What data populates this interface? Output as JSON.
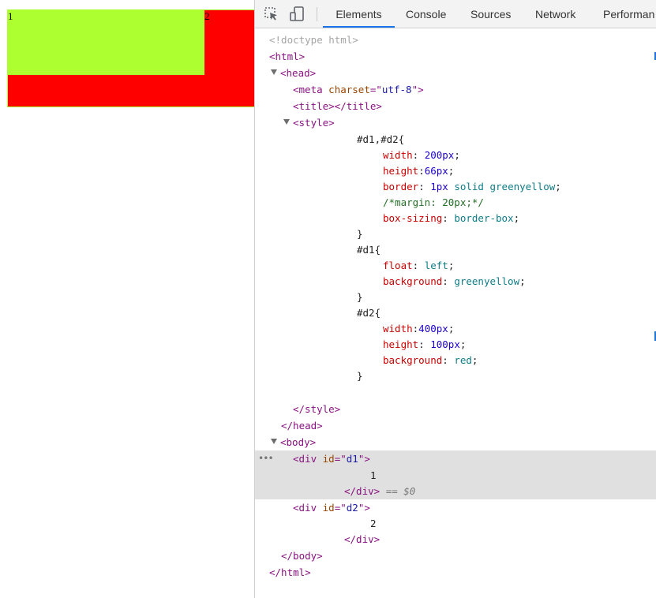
{
  "viewport": {
    "d1_text": "1",
    "d2_text": "2",
    "colors": {
      "d1": "#adff2f",
      "d2": "#ff0000"
    }
  },
  "toolbar": {
    "icons": [
      "inspect-element-icon",
      "device-toolbar-icon"
    ],
    "tabs": [
      "Elements",
      "Console",
      "Sources",
      "Network",
      "Performan"
    ],
    "active_tab": "Elements"
  },
  "dom": {
    "doctype": "<!doctype html>",
    "html_open": "<html>",
    "head_open": "<head>",
    "meta": {
      "tag": "meta",
      "attr": "charset",
      "value": "utf-8"
    },
    "title": "<title></title>",
    "style_open": "<style>",
    "css": {
      "sel_d1d2": "#d1,#d2{",
      "width_prop": "width",
      "width_val": "200px",
      "height_prop": "height",
      "height_val": "66px",
      "border_prop": "border",
      "border_num": "1px",
      "border_kw": "solid",
      "border_color": "greenyellow",
      "margin_comment": "/*margin: 20px;*/",
      "boxsizing_prop": "box-sizing",
      "boxsizing_val": "border-box",
      "close": "}",
      "sel_d1": "#d1{",
      "float_prop": "float",
      "float_val": "left",
      "bg_prop": "background",
      "bg_d1_val": "greenyellow",
      "sel_d2": "#d2{",
      "width2_val": "400px",
      "height2_val": "100px",
      "bg_d2_val": "red"
    },
    "style_close": "</style>",
    "head_close": "</head>",
    "body_open": "<body>",
    "div": {
      "tag": "div",
      "attr": "id",
      "d1": "d1",
      "d2": "d2",
      "close": "</div>"
    },
    "d1_text": "1",
    "d2_text": "2",
    "selected_marker": "== $0",
    "body_close": "</body>",
    "html_close": "</html>"
  }
}
